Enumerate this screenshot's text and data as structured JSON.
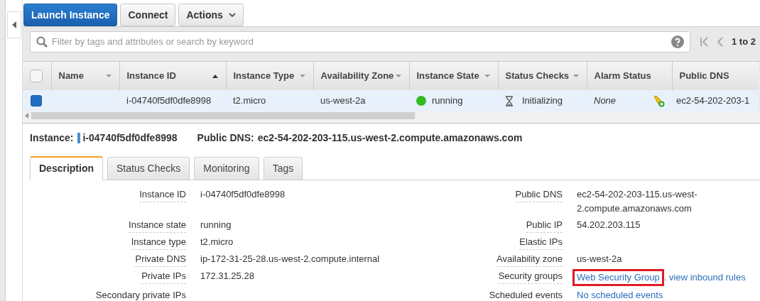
{
  "toolbar": {
    "buttons": [
      {
        "label": "Launch Instance",
        "kind": "primary"
      },
      {
        "label": "Connect",
        "kind": "default"
      },
      {
        "label": "Actions",
        "kind": "dropdown"
      }
    ]
  },
  "search": {
    "placeholder": "Filter by tags and attributes or search by keyword"
  },
  "pagination": {
    "range": "1 to 2"
  },
  "table": {
    "select_all": {
      "checked": false
    },
    "columns": [
      {
        "label": "Name",
        "sorted": false,
        "menu": true
      },
      {
        "label": "Instance ID",
        "sorted": true,
        "menu": false
      },
      {
        "label": "Instance Type",
        "sorted": false,
        "menu": true
      },
      {
        "label": "Availability Zone",
        "sorted": false,
        "menu": true
      },
      {
        "label": "Instance State",
        "sorted": false,
        "menu": true
      },
      {
        "label": "Status Checks",
        "sorted": false,
        "menu": true
      },
      {
        "label": "Alarm Status",
        "sorted": false,
        "menu": false
      },
      {
        "label": "Public DNS",
        "sorted": false,
        "menu": false
      }
    ],
    "rows": [
      {
        "selected": true,
        "name": "",
        "instance_id": "i-04740f5df0dfe8998",
        "instance_type": "t2.micro",
        "zone": "us-west-2a",
        "state": "running",
        "state_ok": true,
        "status_checks": "Initializing",
        "alarm_status": "None",
        "public_dns": "ec2-54-202-203-1"
      }
    ]
  },
  "details": {
    "instance_label": "Instance:",
    "instance_id": "i-04740f5df0dfe8998",
    "dns_label": "Public DNS:",
    "dns": "ec2-54-202-203-115.us-west-2.compute.amazonaws.com",
    "tabs": [
      {
        "label": "Description",
        "selected": true
      },
      {
        "label": "Status Checks",
        "selected": false
      },
      {
        "label": "Monitoring",
        "selected": false
      },
      {
        "label": "Tags",
        "selected": false
      }
    ],
    "left_fields": [
      {
        "label": "Instance ID",
        "values": [
          {
            "text": "i-04740f5df0dfe8998",
            "kind": "text"
          }
        ]
      },
      {
        "label": "Instance state",
        "values": [
          {
            "text": "running",
            "kind": "text"
          }
        ]
      },
      {
        "label": "Instance type",
        "values": [
          {
            "text": "t2.micro",
            "kind": "text"
          }
        ]
      },
      {
        "label": "Private DNS",
        "values": [
          {
            "text": "ip-172-31-25-28.us-west-2.compute.internal",
            "kind": "text"
          }
        ]
      },
      {
        "label": "Private IPs",
        "values": [
          {
            "text": "172.31.25.28",
            "kind": "text"
          }
        ]
      },
      {
        "label": "Secondary private IPs"
      }
    ],
    "right_fields": [
      {
        "label": "Public DNS",
        "values": [
          {
            "text": "ec2-54-202-203-115.us-west-2.compute.amazonaws.com",
            "kind": "text"
          }
        ]
      },
      {
        "label": "Public IP",
        "values": [
          {
            "text": "54.202.203.115",
            "kind": "text"
          }
        ]
      },
      {
        "label": "Elastic IPs"
      },
      {
        "label": "Availability zone",
        "values": [
          {
            "text": "us-west-2a",
            "kind": "text"
          }
        ]
      },
      {
        "label": "Security groups",
        "values": [
          {
            "text": "Web Security Group",
            "kind": "link",
            "highlighted": true
          },
          {
            "text": ". view inbound rules",
            "kind": "link",
            "highlighted": false
          }
        ]
      },
      {
        "label": "Scheduled events",
        "values": [
          {
            "text": "No scheduled events",
            "kind": "link"
          }
        ]
      }
    ]
  }
}
